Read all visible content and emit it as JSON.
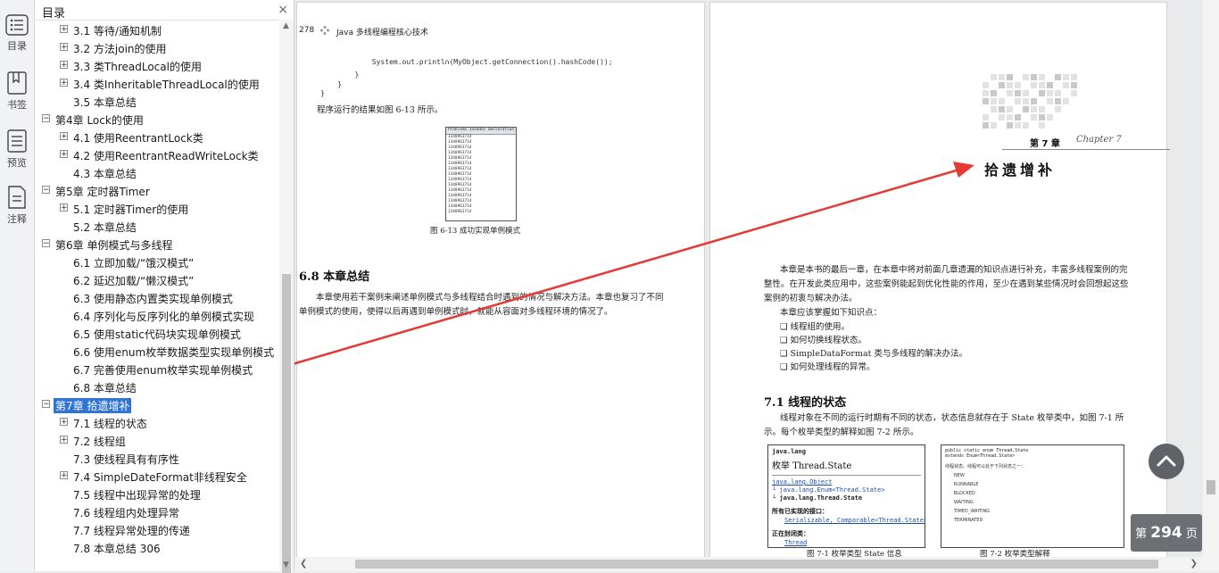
{
  "sidebar_rail": {
    "items": [
      {
        "label": "目录",
        "icon": "list-icon"
      },
      {
        "label": "书签",
        "icon": "bookmark-icon"
      },
      {
        "label": "预览",
        "icon": "preview-icon"
      },
      {
        "label": "注释",
        "icon": "annotation-icon"
      }
    ]
  },
  "toc": {
    "title": "目录",
    "close": "×",
    "items": [
      {
        "label": "3.1 等待/通知机制",
        "level": 2,
        "expandable": true
      },
      {
        "label": "3.2 方法join的使用",
        "level": 2,
        "expandable": true
      },
      {
        "label": "3.3 类ThreadLocal的使用",
        "level": 2,
        "expandable": true
      },
      {
        "label": "3.4 类InheritableThreadLocal的使用",
        "level": 2,
        "expandable": true
      },
      {
        "label": "3.5 本章总结",
        "level": 2,
        "expandable": false
      },
      {
        "label": "第4章 Lock的使用",
        "level": 1,
        "expandable": true
      },
      {
        "label": "4.1 使用ReentrantLock类",
        "level": 2,
        "expandable": true
      },
      {
        "label": "4.2 使用ReentrantReadWriteLock类",
        "level": 2,
        "expandable": true
      },
      {
        "label": "4.3 本章总结",
        "level": 2,
        "expandable": false
      },
      {
        "label": "第5章 定时器Timer",
        "level": 1,
        "expandable": true
      },
      {
        "label": "5.1 定时器Timer的使用",
        "level": 2,
        "expandable": true
      },
      {
        "label": "5.2 本章总结",
        "level": 2,
        "expandable": false
      },
      {
        "label": "第6章 单例模式与多线程",
        "level": 1,
        "expandable": true
      },
      {
        "label": "6.1 立即加载/“饿汉模式”",
        "level": 2,
        "expandable": false
      },
      {
        "label": "6.2 延迟加载/“懒汉模式”",
        "level": 2,
        "expandable": false
      },
      {
        "label": "6.3 使用静态内置类实现单例模式",
        "level": 2,
        "expandable": false
      },
      {
        "label": "6.4 序列化与反序列化的单例模式实现",
        "level": 2,
        "expandable": false
      },
      {
        "label": "6.5 使用static代码块实现单例模式",
        "level": 2,
        "expandable": false
      },
      {
        "label": "6.6 使用enum枚举数据类型实现单例模式",
        "level": 2,
        "expandable": false
      },
      {
        "label": "6.7 完善使用enum枚举实现单例模式",
        "level": 2,
        "expandable": false
      },
      {
        "label": "6.8 本章总结",
        "level": 2,
        "expandable": false
      },
      {
        "label": "第7章 拾遗增补",
        "level": 1,
        "expandable": true,
        "selected": true
      },
      {
        "label": "7.1 线程的状态",
        "level": 2,
        "expandable": true
      },
      {
        "label": "7.2 线程组",
        "level": 2,
        "expandable": true
      },
      {
        "label": "7.3 使线程具有有序性",
        "level": 2,
        "expandable": false
      },
      {
        "label": "7.4 SimpleDateFormat非线程安全",
        "level": 2,
        "expandable": true
      },
      {
        "label": "7.5 线程中出现异常的处理",
        "level": 2,
        "expandable": false
      },
      {
        "label": "7.6 线程组内处理异常",
        "level": 2,
        "expandable": false
      },
      {
        "label": "7.7 线程异常处理的传递",
        "level": 2,
        "expandable": false
      },
      {
        "label": "7.8 本章总结 306",
        "level": 2,
        "expandable": false
      }
    ]
  },
  "left_page": {
    "page_number": "278",
    "running_title": "Java 多线程编程核心技术",
    "code_lines": [
      "            System.out.println(MyObject.getConnection().hashCode());",
      "        }",
      "    }",
      "}"
    ],
    "result_text": "程序运行的结果如图 6-13 所示。",
    "console_header": "Problems  Javadoc  Declaration  Console",
    "console_value": "1340963714",
    "figure_caption": "图 6-13   成功实现单例模式",
    "section_heading": "6.8   本章总结",
    "section_text": "本章使用若干案例来阐述单例模式与多线程结合时遇到的情况与解决方法。本章也复习了不同单例模式的使用，使得以后再遇到单例模式时，就能从容面对多线程环境的情况了。"
  },
  "right_page": {
    "chapter_label": "第 7 章",
    "chapter_script": "Chapter 7",
    "chapter_title": "拾遗增补",
    "intro_1": "本章是本书的最后一章，在本章中将对前面几章遗漏的知识点进行补充，丰富多线程案例的完整性。在开发此类应用中，这些案例能起到优化性能的作用，至少在遇到某些情况时会回想起这些案例的初衷与解决办法。",
    "intro_2": "本章应该掌握如下知识点：",
    "bullets": [
      "线程组的使用。",
      "如何切换线程状态。",
      "SimpleDataFormat 类与多线程的解决办法。",
      "如何处理线程的异常。"
    ],
    "section_heading": "7.1   线程的状态",
    "section_text": "线程对象在不同的运行时期有不同的状态，状态信息就存在于 State 枚举类中，如图 7-1 所示。每个枚举类型的解释如图 7-2 所示。",
    "fig1": {
      "package": "java.lang",
      "title": "枚举 Thread.State",
      "tree": [
        "java.lang.Object",
        "  └ java.lang.Enum<Thread.State>",
        "      └ java.lang.Thread.State"
      ],
      "implements_label": "所有已实现的接口：",
      "implements": "Serializable, Comparable<Thread.State>",
      "enclosing_label": "正在封闭类：",
      "enclosing": "Thread",
      "caption": "图 7-1   枚举类型 State 信息"
    },
    "fig2": {
      "header": "public static enum Thread.State",
      "extends": "extends Enum<Thread.State>",
      "lines": [
        "线程状态。线程可以处于下列状态之一：",
        "NEW",
        "RUNNABLE",
        "BLOCKED",
        "WAITING",
        "TIMED_WAITING",
        "TERMINATED"
      ],
      "caption": "图 7-2   枚举类型解释"
    }
  },
  "page_badge": {
    "prefix": "第",
    "number": "294",
    "suffix": "页"
  },
  "colors": {
    "selection": "#3074d6",
    "arrow": "#e53935"
  }
}
